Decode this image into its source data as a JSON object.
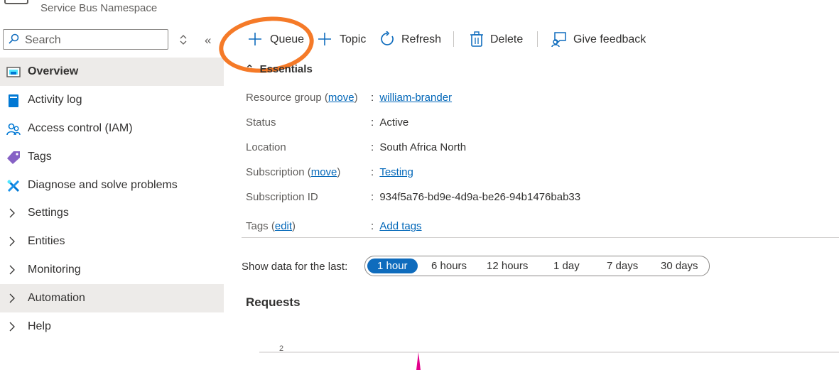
{
  "header": {
    "subtitle": "Service Bus Namespace"
  },
  "sidebar": {
    "search_placeholder": "Search",
    "items": [
      {
        "label": "Overview"
      },
      {
        "label": "Activity log"
      },
      {
        "label": "Access control (IAM)"
      },
      {
        "label": "Tags"
      },
      {
        "label": "Diagnose and solve problems"
      },
      {
        "label": "Settings"
      },
      {
        "label": "Entities"
      },
      {
        "label": "Monitoring"
      },
      {
        "label": "Automation"
      },
      {
        "label": "Help"
      }
    ]
  },
  "toolbar": {
    "queue": "Queue",
    "topic": "Topic",
    "refresh": "Refresh",
    "delete": "Delete",
    "feedback": "Give feedback"
  },
  "essentials": {
    "title": "Essentials",
    "move_link": "move",
    "edit_link": "edit",
    "resource_group_label": "Resource group",
    "resource_group_value": "william-brander",
    "status_label": "Status",
    "status_value": "Active",
    "location_label": "Location",
    "location_value": "South Africa North",
    "subscription_label": "Subscription",
    "subscription_value": "Testing",
    "subscription_id_label": "Subscription ID",
    "subscription_id_value": "934f5a76-bd9e-4d9a-be26-94b1476bab33",
    "tags_label": "Tags",
    "tags_value": "Add tags"
  },
  "time_range": {
    "label": "Show data for the last:",
    "options": [
      "1 hour",
      "6 hours",
      "12 hours",
      "1 day",
      "7 days",
      "30 days"
    ],
    "selected": "1 hour"
  },
  "chart_data": {
    "type": "line",
    "title": "Requests",
    "y_ticks": [
      "2"
    ],
    "series_color": "#e3008c"
  },
  "colors": {
    "annotation": "#f57a28",
    "link": "#0066b8",
    "selected": "#0f6cbd"
  }
}
